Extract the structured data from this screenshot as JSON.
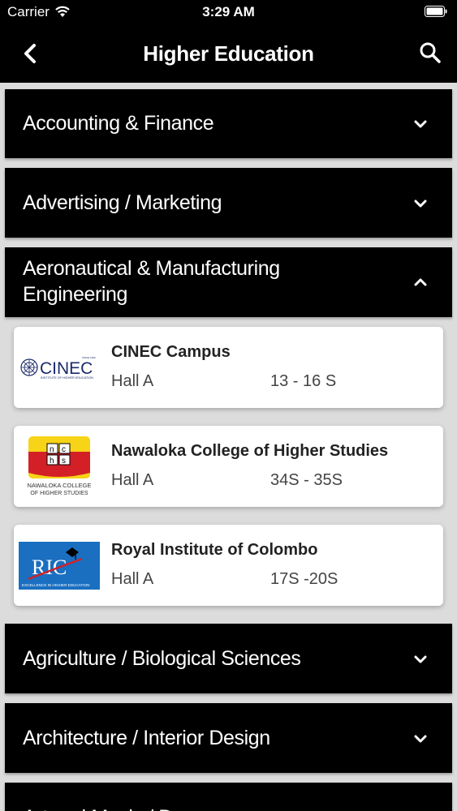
{
  "status": {
    "carrier": "Carrier",
    "time": "3:29 AM"
  },
  "nav": {
    "title": "Higher Education"
  },
  "categories": [
    {
      "label": "Accounting & Finance",
      "expanded": false
    },
    {
      "label": "Advertising / Marketing",
      "expanded": false
    },
    {
      "label_line1": "Aeronautical & Manufacturing",
      "label_line2": "Engineering",
      "expanded": true
    },
    {
      "label": "Agriculture / Biological Sciences",
      "expanded": false
    },
    {
      "label": "Architecture / Interior Design",
      "expanded": false
    },
    {
      "label": "Art and Music / Drama",
      "expanded": false
    }
  ],
  "institutions": [
    {
      "name": "CINEC Campus",
      "hall": "Hall A",
      "stall": "13 - 16 S",
      "logo_text": "CINEC",
      "logo_sub": "INSTITUTE OF HIGHER EDUCATION",
      "logo_top": "SINCE 1990"
    },
    {
      "name": "Nawaloka College of Higher Studies",
      "hall": "Hall A",
      "stall": "34S - 35S",
      "logo_letters": [
        "n",
        "c",
        "h",
        "s"
      ],
      "logo_sub1": "NAWALOKA COLLEGE",
      "logo_sub2": "OF HIGHER STUDIES"
    },
    {
      "name": "Royal Institute of Colombo",
      "hall": "Hall A",
      "stall": "17S -20S",
      "logo_text": "RIC",
      "logo_sub": "EXCELLENCE IN HIGHER EDUCATION"
    }
  ],
  "colors": {
    "bar": "#000000",
    "background": "#dcdcdc",
    "ric_blue": "#1a6fc0",
    "nawaloka_red": "#d32027",
    "nawaloka_yellow": "#f7d417",
    "cinec_navy": "#1c2b6b"
  }
}
